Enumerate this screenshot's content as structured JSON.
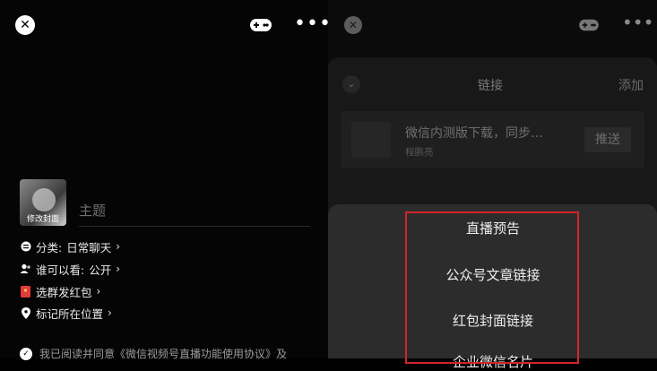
{
  "left": {
    "cover_label": "修改封面",
    "topic_placeholder": "主题",
    "rows": [
      {
        "label": "分类:",
        "value": "日常聊天",
        "icon": "category-icon"
      },
      {
        "label": "谁可以看:",
        "value": "公开",
        "icon": "people-icon"
      },
      {
        "label": "选群发红包",
        "value": "",
        "icon": "red-packet-icon"
      },
      {
        "label": "标记所在位置",
        "value": "",
        "icon": "location-pin-icon"
      }
    ],
    "agreement": "我已阅读并同意《微信视频号直播功能使用协议》及"
  },
  "right": {
    "sheet_title": "链接",
    "add_label": "添加",
    "card_title": "微信内测版下载，同步…",
    "card_subtitle": "程鹏亮",
    "push_label": "推送",
    "menu": [
      "直播预告",
      "公众号文章链接",
      "红包封面链接",
      "企业微信名片"
    ]
  },
  "colors": {
    "highlight_border": "#d3242a"
  }
}
